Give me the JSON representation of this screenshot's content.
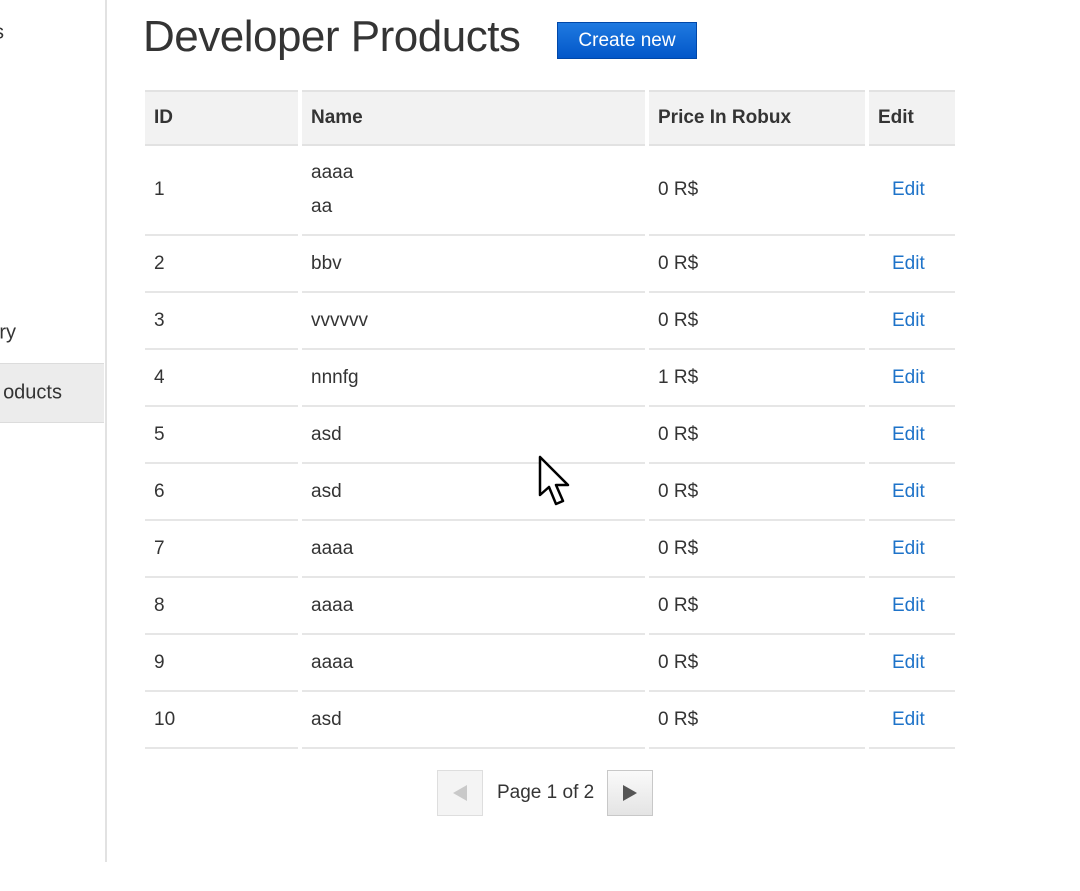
{
  "sidebar": {
    "items": [
      {
        "label": "s"
      },
      {
        "label": "ry"
      },
      {
        "label": "oducts",
        "selected": true
      }
    ]
  },
  "header": {
    "title": "Developer Products",
    "create_button": "Create new"
  },
  "table": {
    "columns": [
      "ID",
      "Name",
      "Price In Robux",
      "Edit"
    ],
    "rows": [
      {
        "id": "1",
        "name_lines": [
          "aaaa",
          "aa"
        ],
        "price": "0 R$",
        "edit": "Edit"
      },
      {
        "id": "2",
        "name": "bbv",
        "price": "0 R$",
        "edit": "Edit"
      },
      {
        "id": "3",
        "name": "vvvvvv",
        "price": "0 R$",
        "edit": "Edit"
      },
      {
        "id": "4",
        "name": "nnnfg",
        "price": "1 R$",
        "edit": "Edit"
      },
      {
        "id": "5",
        "name": "asd",
        "price": "0 R$",
        "edit": "Edit"
      },
      {
        "id": "6",
        "name": "asd",
        "price": "0 R$",
        "edit": "Edit"
      },
      {
        "id": "7",
        "name": "aaaa",
        "price": "0 R$",
        "edit": "Edit"
      },
      {
        "id": "8",
        "name": "aaaa",
        "price": "0 R$",
        "edit": "Edit"
      },
      {
        "id": "9",
        "name": "aaaa",
        "price": "0 R$",
        "edit": "Edit"
      },
      {
        "id": "10",
        "name": "asd",
        "price": "0 R$",
        "edit": "Edit"
      }
    ]
  },
  "pagination": {
    "label": "Page 1 of 2",
    "prev_icon": "triangle-left-icon",
    "next_icon": "triangle-right-icon"
  },
  "colors": {
    "accent": "#0257c9",
    "link": "#1e73c9",
    "header_bg": "#f2f2f2",
    "selected_bg": "#ececec"
  }
}
